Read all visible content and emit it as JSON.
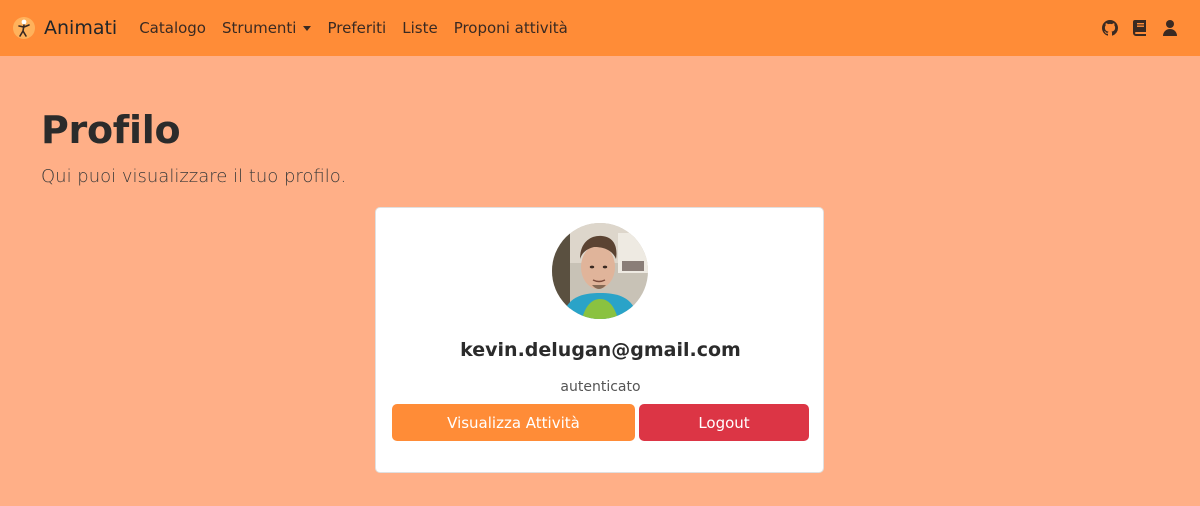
{
  "navbar": {
    "brand": "Animati",
    "links": [
      "Catalogo",
      "Strumenti",
      "Preferiti",
      "Liste",
      "Proponi attività"
    ],
    "icons": [
      "github-icon",
      "book-icon",
      "user-icon"
    ]
  },
  "page": {
    "title": "Profilo",
    "subtitle": "Qui puoi visualizzare il tuo profilo."
  },
  "profile": {
    "email": "kevin.delugan@gmail.com",
    "status": "autenticato",
    "view_activities_label": "Visualizza Attività",
    "logout_label": "Logout"
  },
  "colors": {
    "navbar": "#ff8c37",
    "background": "#ffaf87",
    "primary_button": "#ff8c37",
    "danger_button": "#dc3545"
  }
}
